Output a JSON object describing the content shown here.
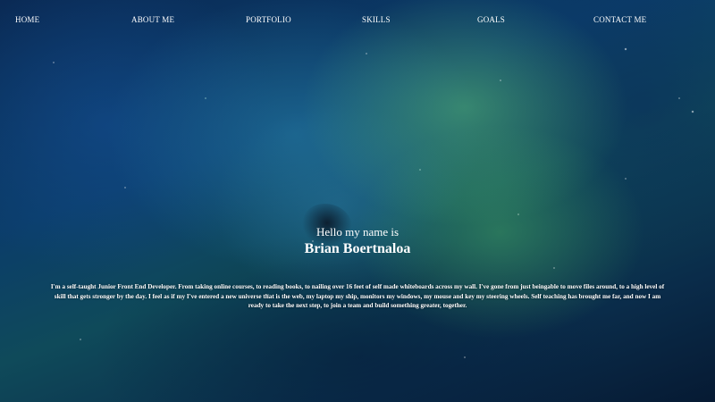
{
  "nav": {
    "items": [
      {
        "label": "HOME"
      },
      {
        "label": "ABOUT ME"
      },
      {
        "label": "PORTFOLIO"
      },
      {
        "label": "SKILLS"
      },
      {
        "label": "GOALS"
      },
      {
        "label": "CONTACT ME"
      }
    ]
  },
  "hero": {
    "greeting": "Hello my name is",
    "name": "Brian Boertnaloa",
    "bio": "I'm a self-taught Junior Front End Developer. From taking online courses, to reading books, to nailing over 16 feet of self made whiteboards across my wall. I've gone from just beingable to move files around, to a high level of skill that gets stronger by the day. I feel as if my I've entered a new universe that is the web, my laptop my ship, monitors my windows, my mouse and key my steering wheels. Self teaching has brought me far, and now I am ready to take the next step, to join a team and build something greater, together."
  },
  "colors": {
    "text": "#ffffff",
    "background_primary": "#0b3d6a",
    "background_accent": "#5abe78"
  }
}
